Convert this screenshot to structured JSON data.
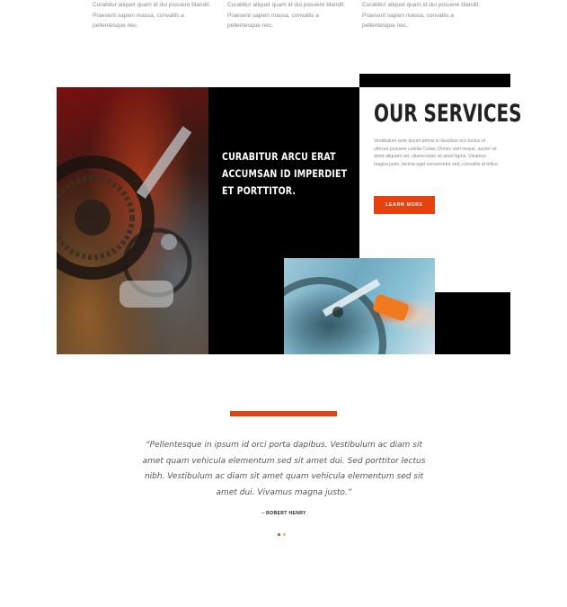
{
  "features": {
    "col1_text": "Curabitur aliquet quam id dui posuere blandit. Praesent sapien massa, convallis a pellentesque nec.",
    "col2_text": "Curabitur aliquet quam id dui posuere blandit. Praesent sapien massa, convallis a pellentesque nec.",
    "col3_text": "Curabitur aliquet quam id dui posuere blandit. Praesent sapien massa, convallis a pellentesque nec."
  },
  "hero": {
    "headline": "CURABITUR ARCU ERAT ACCUMSAN ID IMPERDIET ET PORTTITOR."
  },
  "services": {
    "title": "OUR SERVICES",
    "body": "Vestibulum ante ipsum primis in faucibus orci luctus et ultrices posuere cubilia Curae; Donec velit neque, auctor sit amet aliquam vel, ullamcorper sit amet ligula. Vivamus magna justo, lacinia eget consectetur sed, convallis at tellus.",
    "button_label": "LEARN MORE"
  },
  "testimonial": {
    "quote": "“Pellentesque in ipsum id orci porta dapibus. Vestibulum ac diam sit amet quam vehicula elementum sed sit amet dui. Sed porttitor lectus nibh. Vestibulum ac diam sit amet quam vehicula elementum sed sit amet dui. Vivamus magna justo.”",
    "author": "– ROBERT HENRY",
    "slides": 2,
    "active_slide": 1
  },
  "colors": {
    "accent": "#e84110",
    "dark": "#000000"
  }
}
